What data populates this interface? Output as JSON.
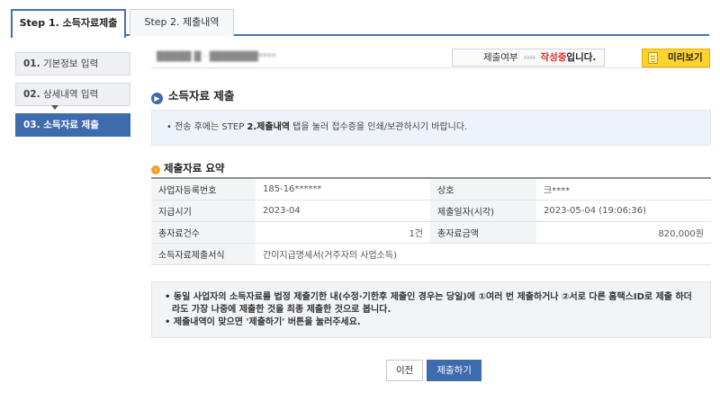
{
  "tabs": [
    {
      "label": "Step 1. 소득자료제출"
    },
    {
      "label": "Step 2. 제출내역"
    }
  ],
  "steps": [
    {
      "num": "01.",
      "label": "기본정보 입력"
    },
    {
      "num": "02.",
      "label": "상세내역 입력"
    },
    {
      "num": "03.",
      "label": "소득자료 제출"
    }
  ],
  "header": {
    "blurred_text": "█████ █ · ███████****",
    "status_label": "제출여부",
    "status_arrows": "››››",
    "status_value": "작성중",
    "status_suffix": "입니다.",
    "preview_label": "미리보기"
  },
  "section": {
    "title": "소득자료 제출"
  },
  "notice1": {
    "prefix": "• 전송 후에는 STEP ",
    "bold": "2.제출내역",
    "suffix": " 탭을 눌러 접수증을 인쇄/보관하시기 바랍니다."
  },
  "summary": {
    "title": "제출자료 요약",
    "rows": [
      {
        "l1": "사업자등록번호",
        "v1": "185-16******",
        "l2": "상호",
        "v2": "크****"
      },
      {
        "l1": "지급시기",
        "v1": "2023-04",
        "l2": "제출일자(시각)",
        "v2": "2023-05-04 (19:06:36)"
      },
      {
        "l1": "총자료건수",
        "v1": "1건",
        "l2": "총자료금액",
        "v2": "820,000원"
      },
      {
        "l1": "소득자료제출서식",
        "v1": "간이지급명세서(거주자의 사업소득)"
      }
    ]
  },
  "notice2": {
    "line1": "• 동일 사업자의 소득자료를 법정 제출기한 내(수정·기한후 제출인 경우는 당일)에 ①여러 번 제출하거나 ②서로 다른 홈택스ID로 제출 하더라도 가장 나중에 제출한 것을 최종 제출한 것으로 봅니다.",
    "line2": "• 제출내역이 맞으면 '제출하기' 버튼을 눌러주세요."
  },
  "buttons": {
    "prev": "이전",
    "submit": "제출하기"
  },
  "colors": {
    "accent": "#3e6aae",
    "status_red": "#d9332b",
    "preview_yellow": "#ffd32c"
  }
}
